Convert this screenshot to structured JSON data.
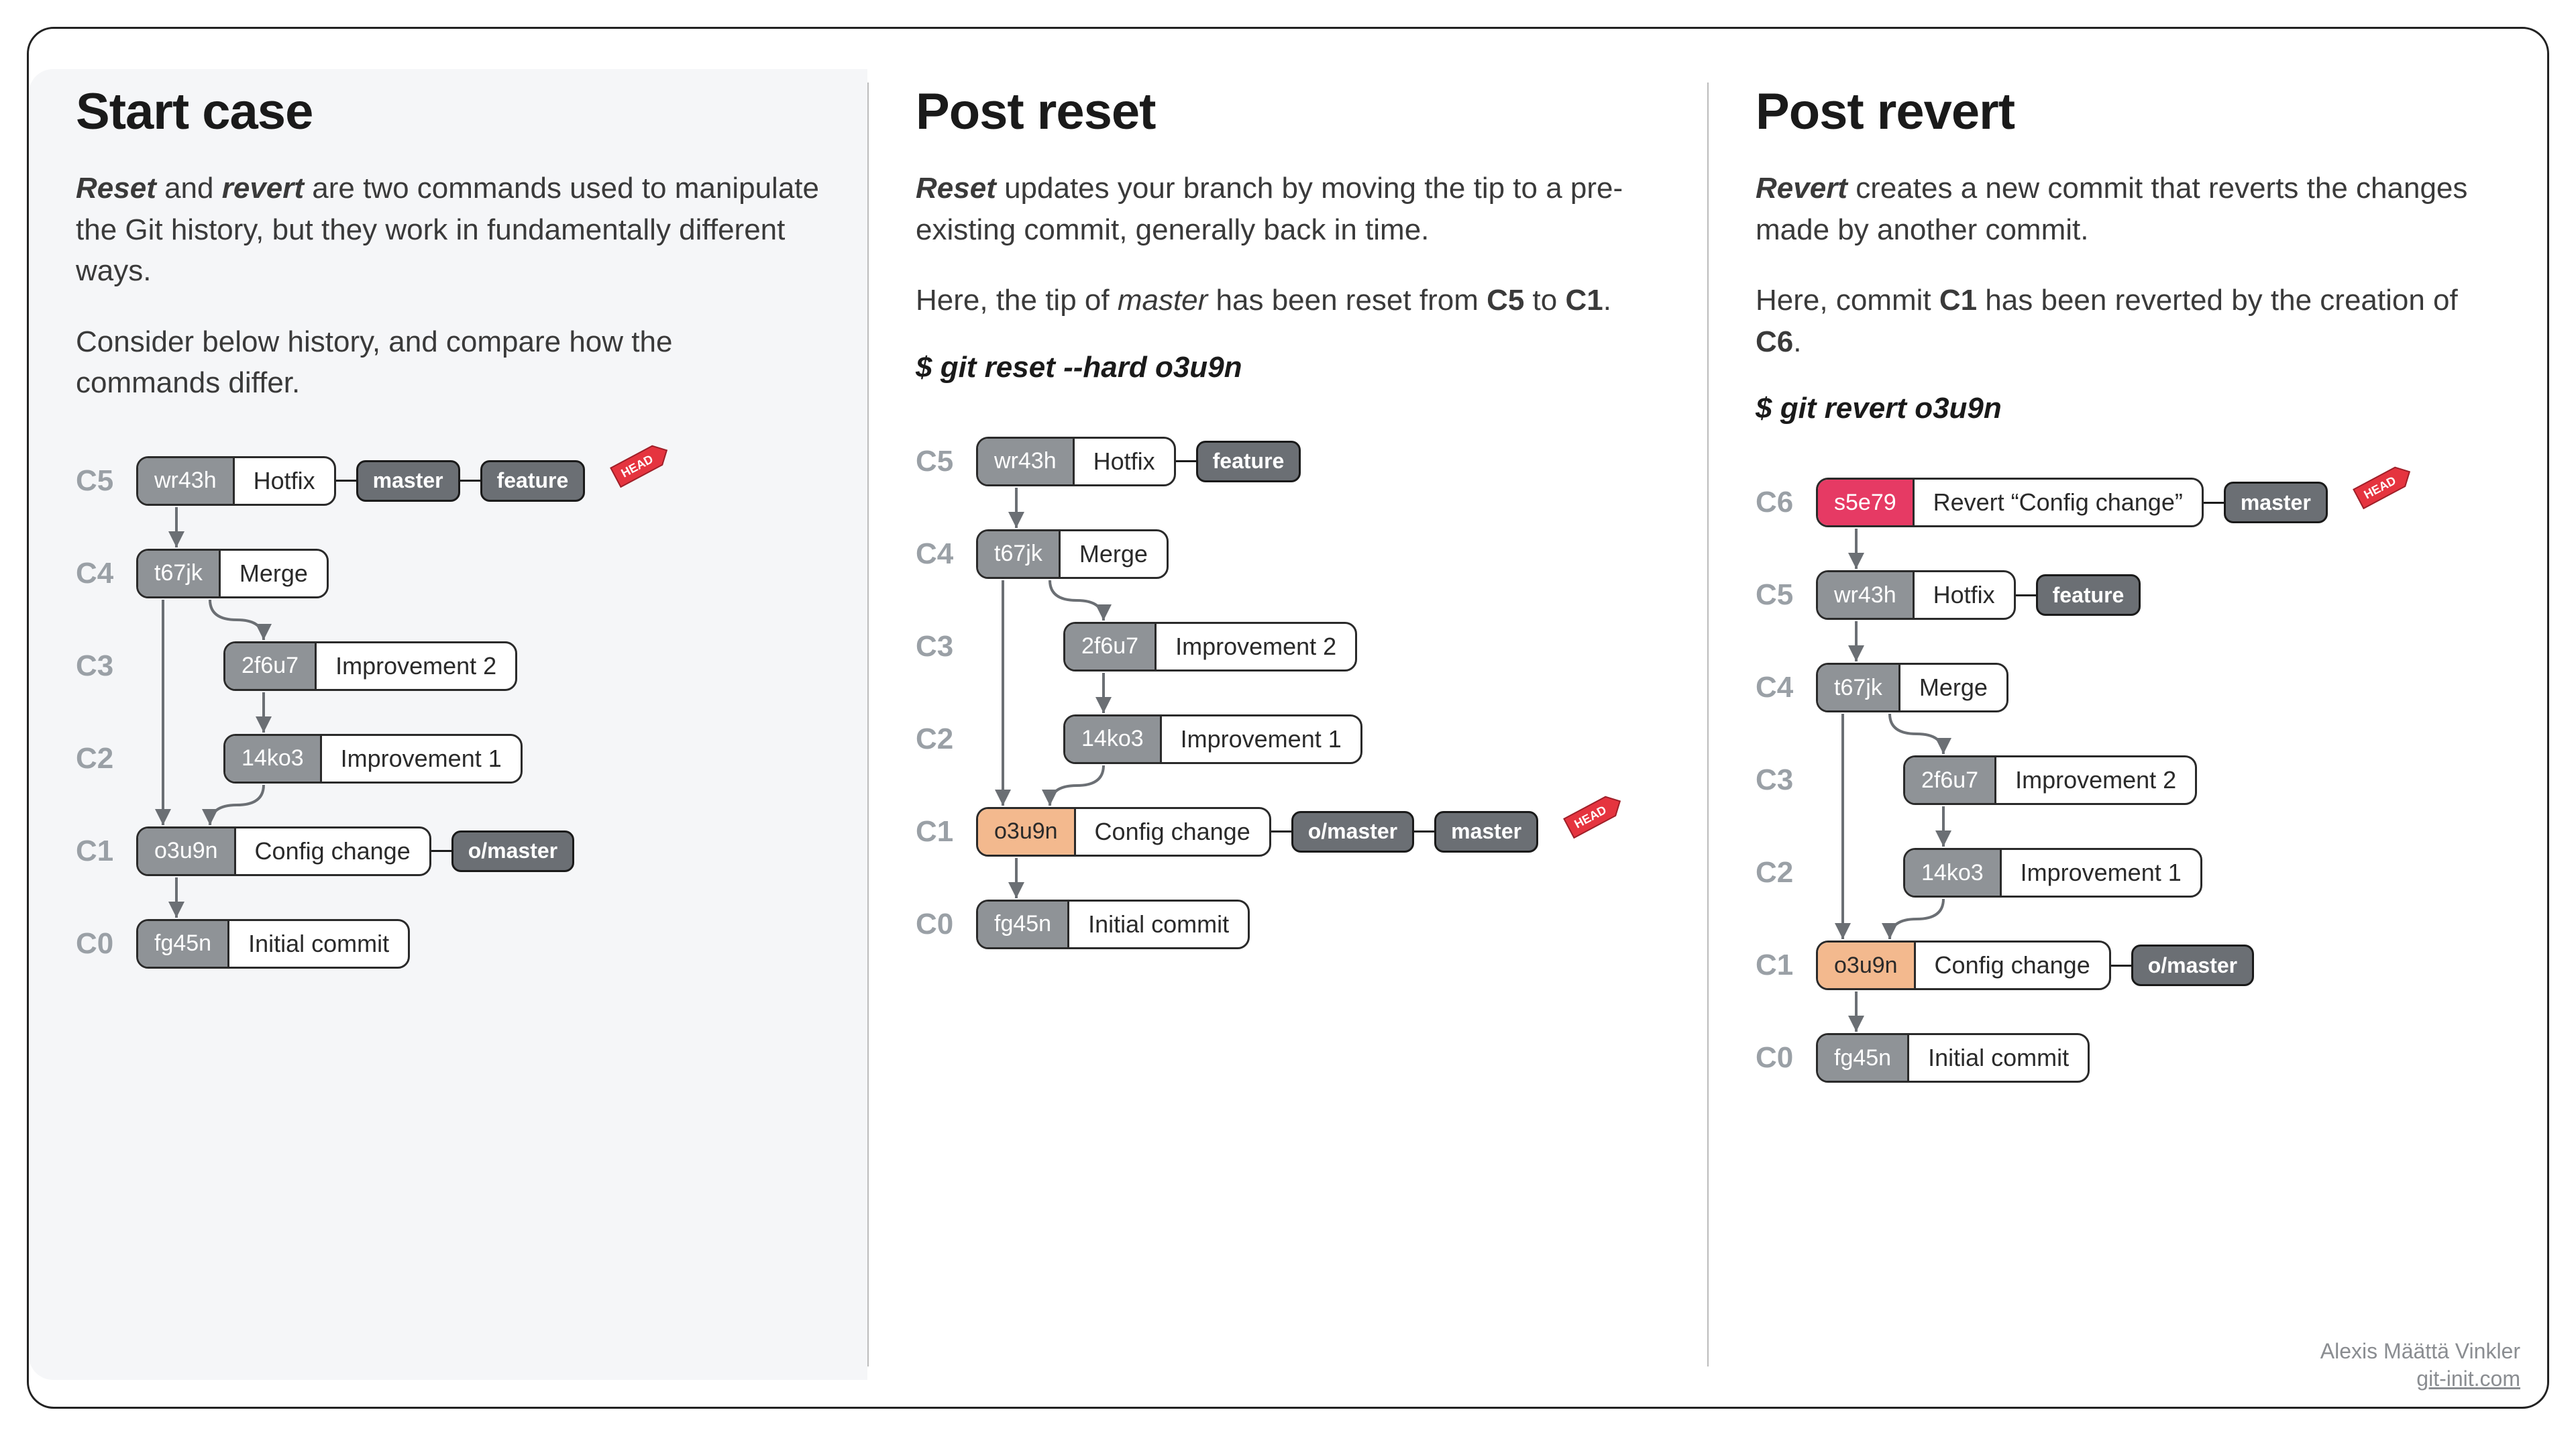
{
  "attribution": {
    "name": "Alexis Määttä Vinkler",
    "site": "git-init.com"
  },
  "columns": [
    {
      "id": "start",
      "title": "Start case",
      "paragraphs": [
        [
          {
            "t": "Reset",
            "cls": "bi"
          },
          {
            "t": " and "
          },
          {
            "t": "revert",
            "cls": "bi"
          },
          {
            "t": " are two commands used to manipulate the Git history, but they work in fundamentally different ways."
          }
        ],
        [
          {
            "t": "Consider below history, and compare how the commands differ."
          }
        ]
      ],
      "command": "",
      "head_on": "C5",
      "rows": [
        {
          "c": "C5",
          "hash": "wr43h",
          "msg": "Hotfix",
          "indent": false,
          "tags": [
            "master",
            "feature"
          ],
          "highlight": false,
          "red": false
        },
        {
          "c": "C4",
          "hash": "t67jk",
          "msg": "Merge",
          "indent": false,
          "tags": [],
          "highlight": false,
          "red": false
        },
        {
          "c": "C3",
          "hash": "2f6u7",
          "msg": "Improvement 2",
          "indent": true,
          "tags": [],
          "highlight": false,
          "red": false
        },
        {
          "c": "C2",
          "hash": "14ko3",
          "msg": "Improvement 1",
          "indent": true,
          "tags": [],
          "highlight": false,
          "red": false
        },
        {
          "c": "C1",
          "hash": "o3u9n",
          "msg": "Config change",
          "indent": false,
          "tags": [
            "o/master"
          ],
          "highlight": false,
          "red": false
        },
        {
          "c": "C0",
          "hash": "fg45n",
          "msg": "Initial commit",
          "indent": false,
          "tags": [],
          "highlight": false,
          "red": false
        }
      ]
    },
    {
      "id": "reset",
      "title": "Post reset",
      "paragraphs": [
        [
          {
            "t": "Reset",
            "cls": "bi"
          },
          {
            "t": " updates your branch by moving the tip to a pre-existing commit, generally back in time."
          }
        ],
        [
          {
            "t": "Here, the tip of "
          },
          {
            "t": "master",
            "cls": "i"
          },
          {
            "t": " has been reset from "
          },
          {
            "t": "C5",
            "cls": "b"
          },
          {
            "t": " to "
          },
          {
            "t": "C1",
            "cls": "b"
          },
          {
            "t": "."
          }
        ]
      ],
      "command": "$ git reset --hard o3u9n",
      "head_on": "C1",
      "rows": [
        {
          "c": "C5",
          "hash": "wr43h",
          "msg": "Hotfix",
          "indent": false,
          "tags": [
            "feature"
          ],
          "highlight": false,
          "red": false
        },
        {
          "c": "C4",
          "hash": "t67jk",
          "msg": "Merge",
          "indent": false,
          "tags": [],
          "highlight": false,
          "red": false
        },
        {
          "c": "C3",
          "hash": "2f6u7",
          "msg": "Improvement 2",
          "indent": true,
          "tags": [],
          "highlight": false,
          "red": false
        },
        {
          "c": "C2",
          "hash": "14ko3",
          "msg": "Improvement 1",
          "indent": true,
          "tags": [],
          "highlight": false,
          "red": false
        },
        {
          "c": "C1",
          "hash": "o3u9n",
          "msg": "Config change",
          "indent": false,
          "tags": [
            "o/master",
            "master"
          ],
          "highlight": true,
          "red": false
        },
        {
          "c": "C0",
          "hash": "fg45n",
          "msg": "Initial commit",
          "indent": false,
          "tags": [],
          "highlight": false,
          "red": false
        }
      ]
    },
    {
      "id": "revert",
      "title": "Post revert",
      "paragraphs": [
        [
          {
            "t": "Revert",
            "cls": "bi"
          },
          {
            "t": " creates a new commit that reverts the changes made by another commit."
          }
        ],
        [
          {
            "t": "Here, commit "
          },
          {
            "t": "C1",
            "cls": "b"
          },
          {
            "t": " has been reverted by the creation of "
          },
          {
            "t": "C6",
            "cls": "b"
          },
          {
            "t": "."
          }
        ]
      ],
      "command": "$ git revert o3u9n",
      "head_on": "C6",
      "rows": [
        {
          "c": "C6",
          "hash": "s5e79",
          "msg": "Revert “Config change”",
          "indent": false,
          "tags": [
            "master"
          ],
          "highlight": false,
          "red": true
        },
        {
          "c": "C5",
          "hash": "wr43h",
          "msg": "Hotfix",
          "indent": false,
          "tags": [
            "feature"
          ],
          "highlight": false,
          "red": false
        },
        {
          "c": "C4",
          "hash": "t67jk",
          "msg": "Merge",
          "indent": false,
          "tags": [],
          "highlight": false,
          "red": false
        },
        {
          "c": "C3",
          "hash": "2f6u7",
          "msg": "Improvement 2",
          "indent": true,
          "tags": [],
          "highlight": false,
          "red": false
        },
        {
          "c": "C2",
          "hash": "14ko3",
          "msg": "Improvement 1",
          "indent": true,
          "tags": [],
          "highlight": false,
          "red": false
        },
        {
          "c": "C1",
          "hash": "o3u9n",
          "msg": "Config change",
          "indent": false,
          "tags": [
            "o/master"
          ],
          "highlight": true,
          "red": false
        },
        {
          "c": "C0",
          "hash": "fg45n",
          "msg": "Initial commit",
          "indent": false,
          "tags": [],
          "highlight": false,
          "red": false
        }
      ]
    }
  ]
}
